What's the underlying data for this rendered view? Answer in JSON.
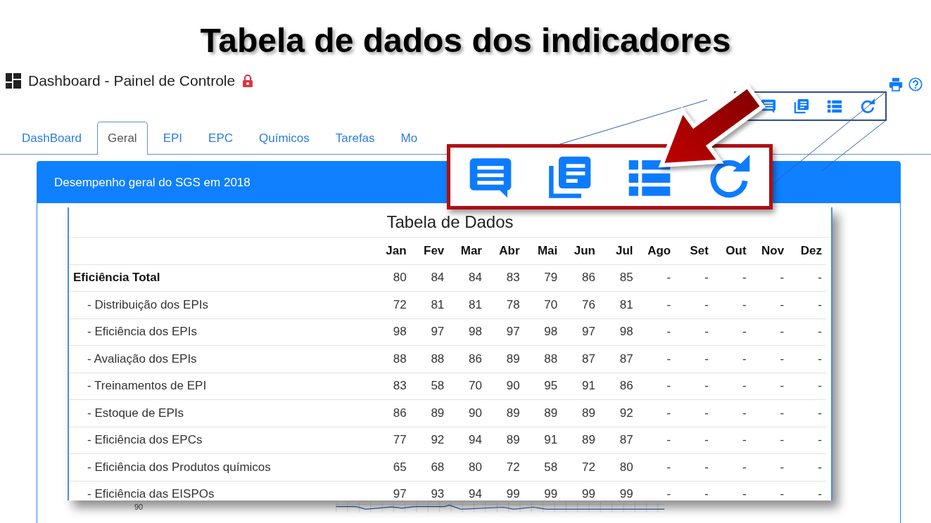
{
  "slide_title": "Tabela de dados dos indicadores",
  "page": {
    "title": "Dashboard - Painel de Controle"
  },
  "tabs": [
    {
      "label": "DashBoard",
      "selected": false
    },
    {
      "label": "Geral",
      "selected": true
    },
    {
      "label": "EPI",
      "selected": false
    },
    {
      "label": "EPC",
      "selected": false
    },
    {
      "label": "Químicos",
      "selected": false
    },
    {
      "label": "Tarefas",
      "selected": false
    },
    {
      "label": "Mo",
      "selected": false
    }
  ],
  "toolbar_buttons": [
    {
      "kind": "comment"
    },
    {
      "kind": "documents"
    },
    {
      "kind": "list"
    },
    {
      "kind": "refresh"
    }
  ],
  "card": {
    "title": "Desempenho geral do SGS em 2018"
  },
  "data_table": {
    "title": "Tabela de Dados",
    "months": [
      "Jan",
      "Fev",
      "Mar",
      "Abr",
      "Mai",
      "Jun",
      "Jul",
      "Ago",
      "Set",
      "Out",
      "Nov",
      "Dez"
    ],
    "rows": [
      {
        "label": "Eficiência Total",
        "values": [
          "80",
          "84",
          "84",
          "83",
          "79",
          "86",
          "85",
          "-",
          "-",
          "-",
          "-",
          "-"
        ],
        "children": [
          {
            "label": "- Distribuição dos EPIs",
            "values": [
              "72",
              "81",
              "81",
              "78",
              "70",
              "76",
              "81",
              "-",
              "-",
              "-",
              "-",
              "-"
            ]
          },
          {
            "label": "- Eficiência dos EPIs",
            "values": [
              "98",
              "97",
              "98",
              "97",
              "98",
              "97",
              "98",
              "-",
              "-",
              "-",
              "-",
              "-"
            ]
          },
          {
            "label": "- Avaliação dos EPIs",
            "values": [
              "88",
              "88",
              "86",
              "89",
              "88",
              "87",
              "87",
              "-",
              "-",
              "-",
              "-",
              "-"
            ]
          },
          {
            "label": "- Treinamentos de EPI",
            "values": [
              "83",
              "58",
              "70",
              "90",
              "95",
              "91",
              "86",
              "-",
              "-",
              "-",
              "-",
              "-"
            ]
          },
          {
            "label": "- Estoque de EPIs",
            "values": [
              "86",
              "89",
              "90",
              "89",
              "89",
              "89",
              "92",
              "-",
              "-",
              "-",
              "-",
              "-"
            ]
          },
          {
            "label": "- Eficiência dos EPCs",
            "values": [
              "77",
              "92",
              "94",
              "89",
              "91",
              "89",
              "87",
              "-",
              "-",
              "-",
              "-",
              "-"
            ]
          },
          {
            "label": "- Eficiência dos Produtos químicos",
            "values": [
              "65",
              "68",
              "80",
              "72",
              "58",
              "72",
              "80",
              "-",
              "-",
              "-",
              "-",
              "-"
            ]
          },
          {
            "label": "- Eficiência das EISPOs",
            "values": [
              "97",
              "93",
              "94",
              "99",
              "99",
              "99",
              "99",
              "-",
              "-",
              "-",
              "-",
              "-"
            ]
          }
        ]
      }
    ]
  },
  "chart": {
    "axis_label": "90"
  }
}
